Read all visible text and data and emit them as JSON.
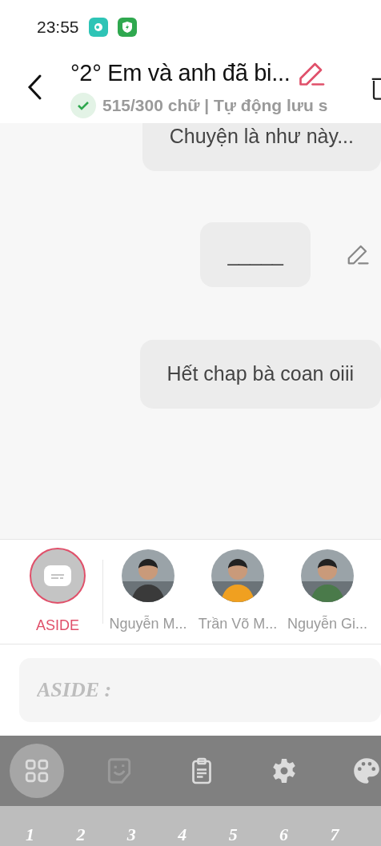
{
  "status_bar": {
    "time": "23:55"
  },
  "header": {
    "title": "°2° Em và anh đã bi...",
    "subtitle": "515/300 chữ | Tự động lưu s"
  },
  "messages": [
    {
      "text": "Chuyện là như này...",
      "editable": false
    },
    {
      "text": "_____",
      "editable": true
    },
    {
      "text": "Hết chap bà coan oiii",
      "editable": false
    }
  ],
  "characters": [
    {
      "kind": "aside",
      "name": "ASIDE",
      "selected": true
    },
    {
      "kind": "person",
      "name": "Nguyễn M...",
      "selected": false,
      "color": "#3a3a3a"
    },
    {
      "kind": "person",
      "name": "Trần Võ M...",
      "selected": false,
      "color": "#f0a020"
    },
    {
      "kind": "person",
      "name": "Nguyễn Gi...",
      "selected": false,
      "color": "#4a7a4a"
    }
  ],
  "input": {
    "placeholder": "ASIDE :"
  },
  "toolbar": [
    {
      "kind": "grid",
      "selected": true,
      "disabled": false
    },
    {
      "kind": "sticker",
      "selected": false,
      "disabled": true
    },
    {
      "kind": "clipboard",
      "selected": false,
      "disabled": false
    },
    {
      "kind": "settings",
      "selected": false,
      "disabled": false
    },
    {
      "kind": "palette",
      "selected": false,
      "disabled": false
    }
  ],
  "keyboard": {
    "keys": [
      "1",
      "2",
      "3",
      "4",
      "5",
      "6",
      "7"
    ]
  }
}
